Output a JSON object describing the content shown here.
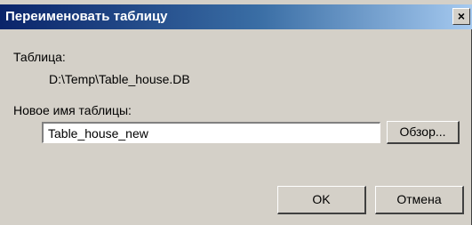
{
  "window": {
    "title": "Переименовать таблицу",
    "close_glyph": "×",
    "colors": {
      "titlebar_start": "#0a246a",
      "titlebar_end": "#a6caf0",
      "face": "#d4d0c8"
    }
  },
  "form": {
    "table_label": "Таблица:",
    "table_path": "D:\\Temp\\Table_house.DB",
    "new_name_label": "Новое имя таблицы:",
    "new_name_value": "Table_house_new"
  },
  "buttons": {
    "browse": "Обзор...",
    "ok": "OK",
    "cancel": "Отмена"
  }
}
